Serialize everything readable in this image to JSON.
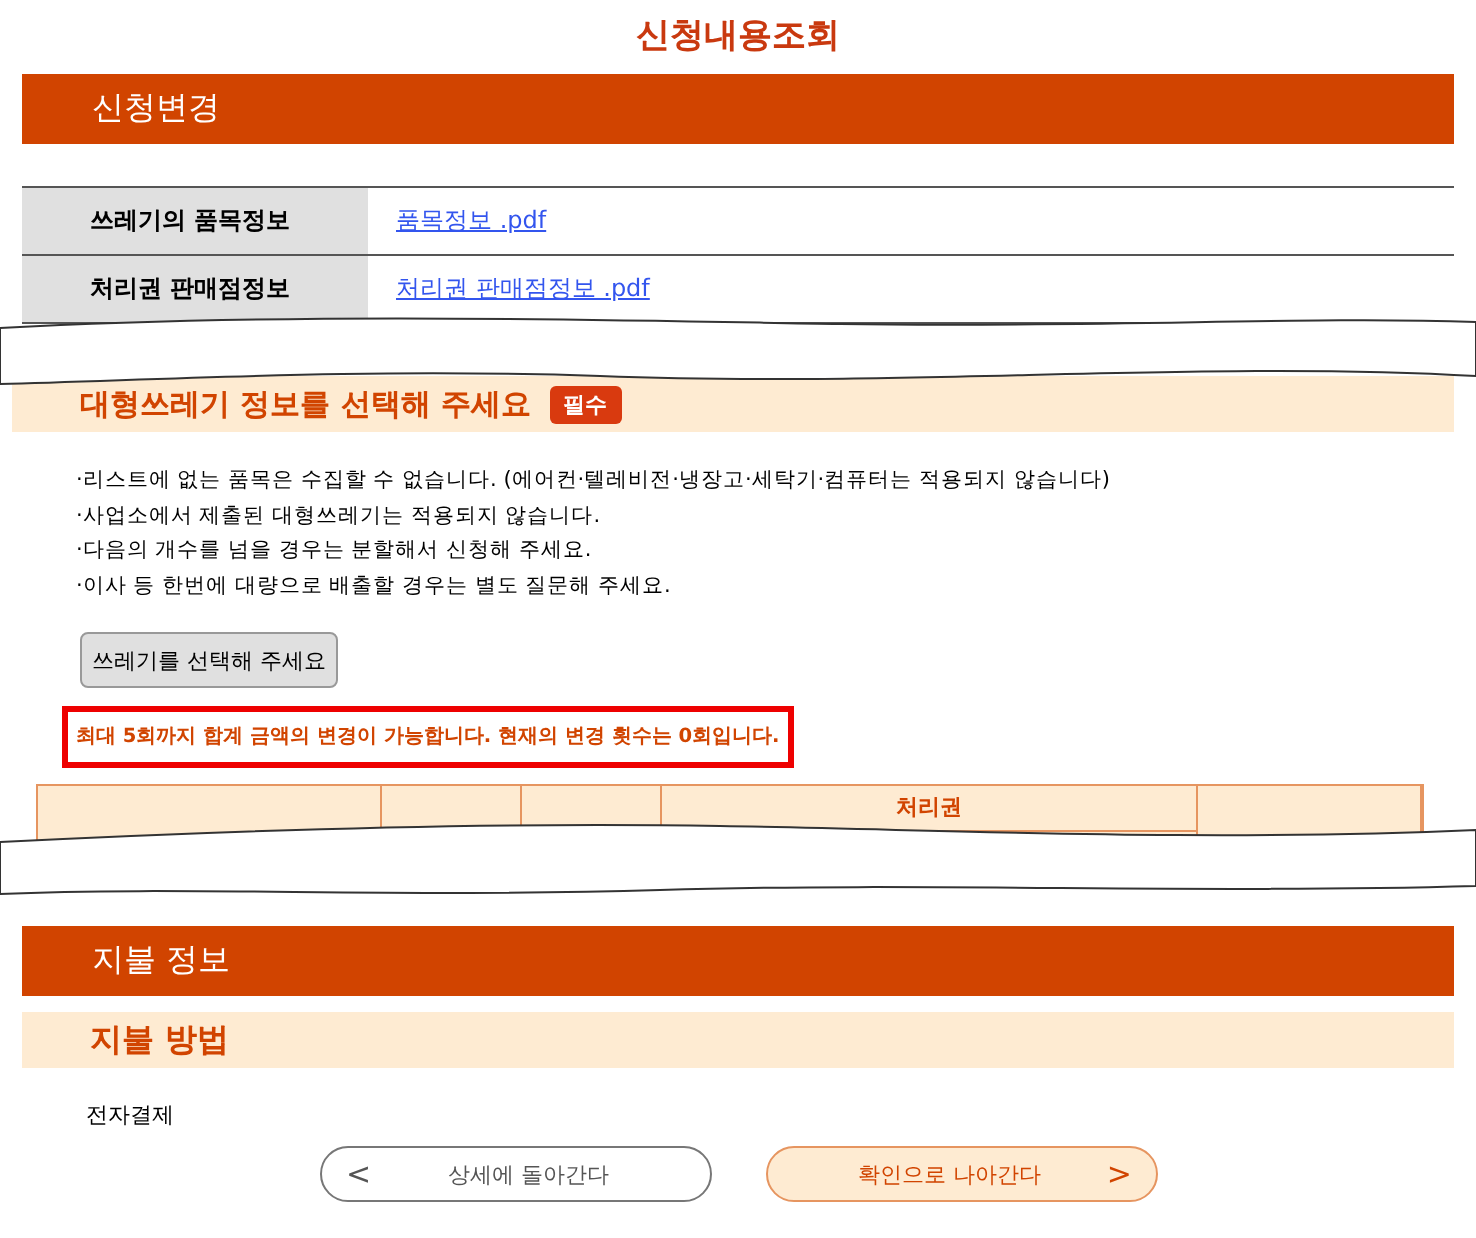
{
  "page_title": "신청내용조회",
  "change_section": {
    "title": "신청변경",
    "rows": [
      {
        "label": "쓰레기의 품목정보",
        "link": "품목정보 .pdf"
      },
      {
        "label": "처리권 판매점정보",
        "link": "처리권 판매점정보 .pdf"
      }
    ]
  },
  "select_section": {
    "title": "대형쓰레기 정보를 선택해 주세요",
    "badge": "필수",
    "notes": [
      "·리스트에 없는 품목은 수집할 수 없습니다. (에어컨·텔레비전·냉장고·세탁기·컴퓨터는 적용되지 않습니다)",
      "·사업소에서 제출된 대형쓰레기는 적용되지 않습니다.",
      "·다음의 개수를 넘을 경우는 분할해서 신청해 주세요.",
      "·이사 등 한번에 대량으로 배출할 경우는 별도 질문해 주세요."
    ],
    "select_button": "쓰레기를 선택해 주세요",
    "warning": "최대 5회까지 합계 금액의 변경이 가능합니다. 현재의 변경 횟수는 0회입니다.",
    "table": {
      "group_header": "처리권"
    }
  },
  "payment_section": {
    "title": "지불 정보",
    "subtitle": "지불 방법",
    "method": "전자결제"
  },
  "nav": {
    "back": {
      "arrow": "<",
      "label": "상세에 돌아간다"
    },
    "next": {
      "label": "확인으로 나아간다",
      "arrow": ">"
    }
  }
}
